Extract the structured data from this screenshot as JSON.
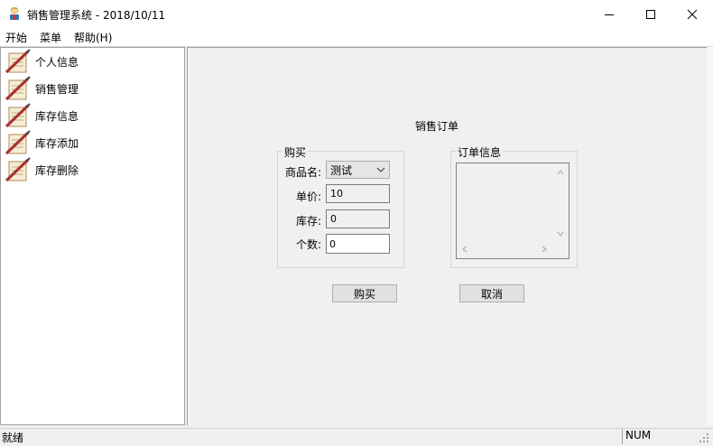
{
  "window": {
    "title": "销售管理系统 - 2018/10/11"
  },
  "menu": {
    "items": [
      "开始",
      "菜单",
      "帮助(H)"
    ]
  },
  "tree": {
    "items": [
      "个人信息",
      "销售管理",
      "库存信息",
      "库存添加",
      "库存删除"
    ]
  },
  "form": {
    "heading": "销售订单",
    "purchase_group": "购买",
    "order_group": "订单信息",
    "product_label": "商品名:",
    "product_value": "测试",
    "price_label": "单价:",
    "price_value": "10",
    "stock_label": "库存:",
    "stock_value": "0",
    "quantity_label": "个数:",
    "quantity_value": "0",
    "buy_button": "购买",
    "cancel_button": "取消"
  },
  "status": {
    "text": "就绪",
    "num": "NUM"
  }
}
